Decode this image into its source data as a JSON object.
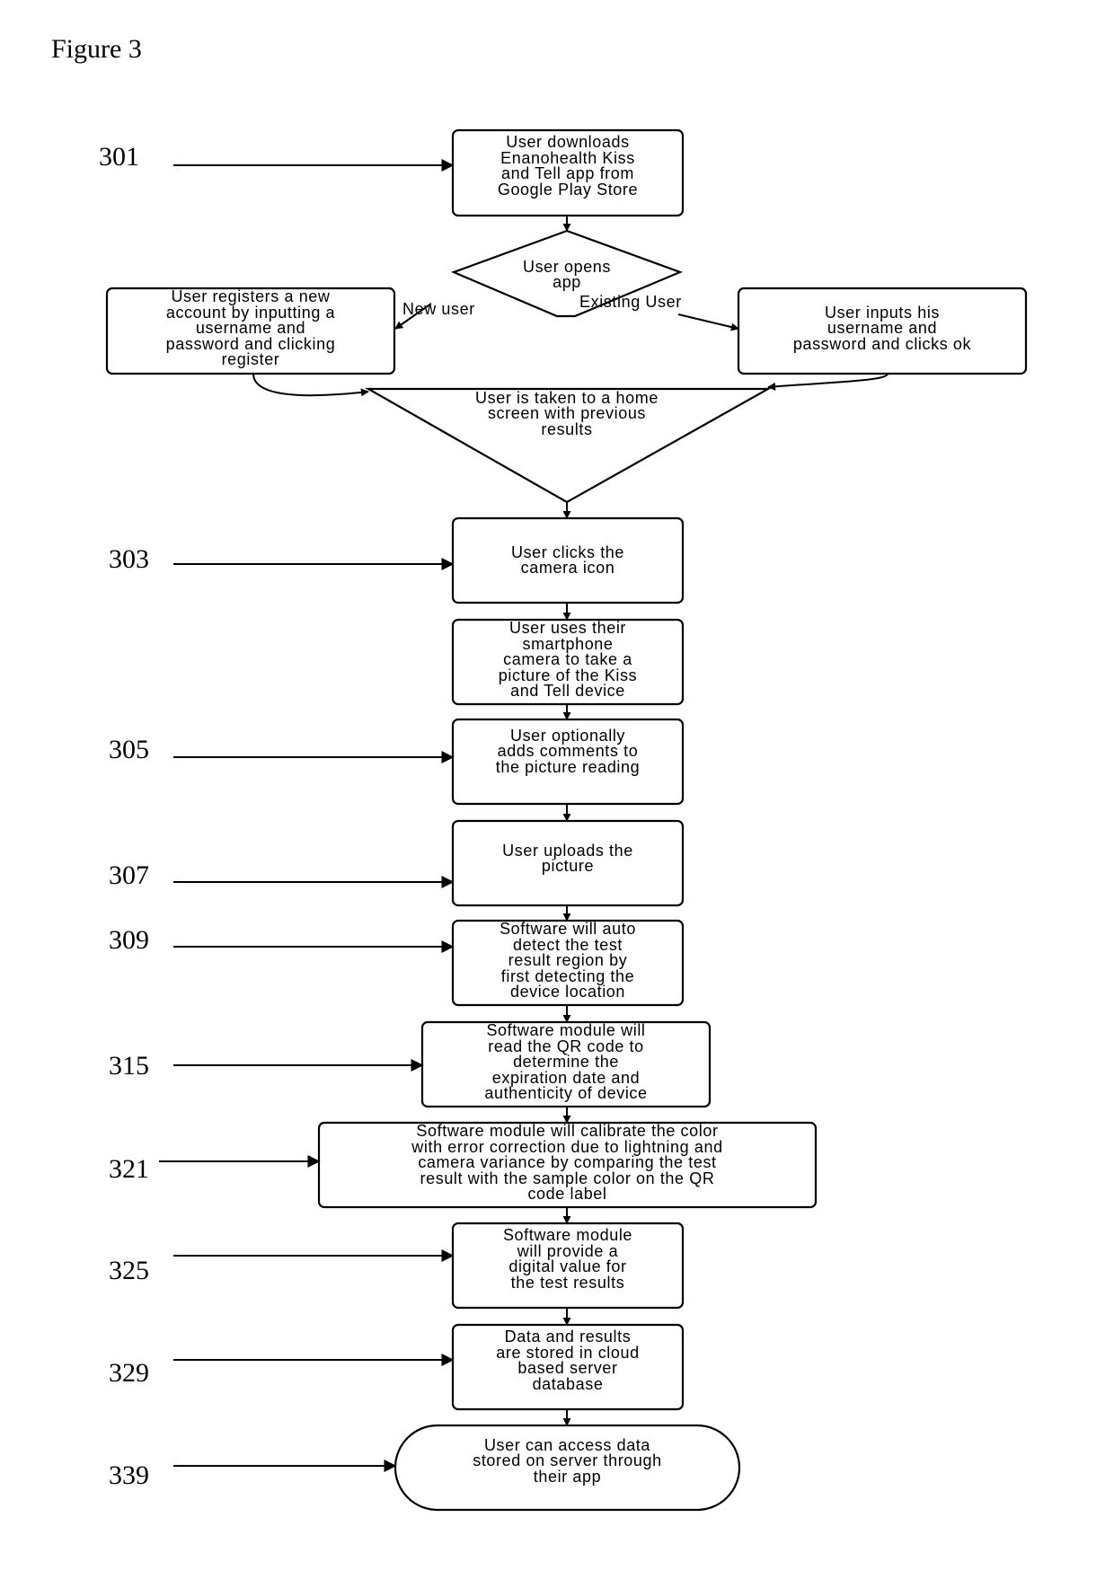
{
  "figure": {
    "title": "Figure 3"
  },
  "refs": {
    "r301": "301",
    "r303": "303",
    "r305": "305",
    "r307": "307",
    "r309": "309",
    "r315": "315",
    "r321": "321",
    "r325": "325",
    "r329": "329",
    "r339": "339"
  },
  "nodes": {
    "download": "User downloads\nEnanohealth Kiss\nand Tell app from\nGoogle Play Store",
    "opens_app": "User opens\napp",
    "register": "User registers a new\naccount by inputting a\nusername and\npassword and clicking\nregister",
    "login": "User inputs his\nusername and\npassword and clicks ok",
    "home": "User is taken to a home\nscreen with previous\nresults",
    "camera_icon": "User clicks the\ncamera icon",
    "take_picture": "User uses their\nsmartphone\ncamera to take a\npicture of the Kiss\nand Tell device",
    "comments": "User optionally\nadds comments to\nthe picture reading",
    "upload": "User uploads the\npicture",
    "auto_detect": "Software will auto\ndetect the test\nresult region by\nfirst detecting the\ndevice location",
    "read_qr": "Software module will\nread the QR code to\ndetermine the\nexpiration date and\nauthenticity of device",
    "calibrate": "Software module will calibrate the color\nwith error correction due to lightning and\ncamera variance by comparing the test\nresult with the sample color on the QR\ncode label",
    "digital_value": "Software module\nwill provide a\ndigital value for\nthe test results",
    "stored": "Data and results\nare stored in cloud\nbased server\ndatabase",
    "access": "User can access data\nstored on server through\ntheir app"
  },
  "edges": {
    "new_user": "New user",
    "existing_user": "Existing User"
  }
}
